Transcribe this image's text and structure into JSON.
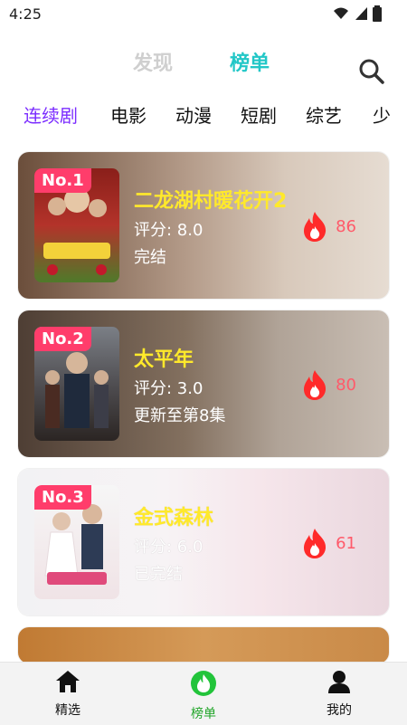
{
  "status_bar": {
    "time": "4:25"
  },
  "top_tabs": {
    "discover": "发现",
    "ranking": "榜单"
  },
  "categories": [
    "连续剧",
    "电影",
    "动漫",
    "短剧",
    "综艺",
    "少"
  ],
  "cards": [
    {
      "rank": "No.1",
      "title": "二龙湖村暖花开2",
      "score": "评分: 8.0",
      "status": "完结",
      "heat": "86"
    },
    {
      "rank": "No.2",
      "title": "太平年",
      "score": "评分: 3.0",
      "status": "更新至第8集",
      "heat": "80"
    },
    {
      "rank": "No.3",
      "title": "金式森林",
      "score": "评分: 6.0",
      "status": "已完结",
      "heat": "61"
    }
  ],
  "bottom_nav": {
    "featured": "精选",
    "ranking": "榜单",
    "mine": "我的"
  },
  "colors": {
    "accent_purple": "#7b2cff",
    "accent_teal": "#22c7c7",
    "title_yellow": "#ffe92b",
    "rank_pink": "#ff3d6b",
    "heat_red": "#ff5a6a",
    "nav_active": "#22a52a"
  }
}
